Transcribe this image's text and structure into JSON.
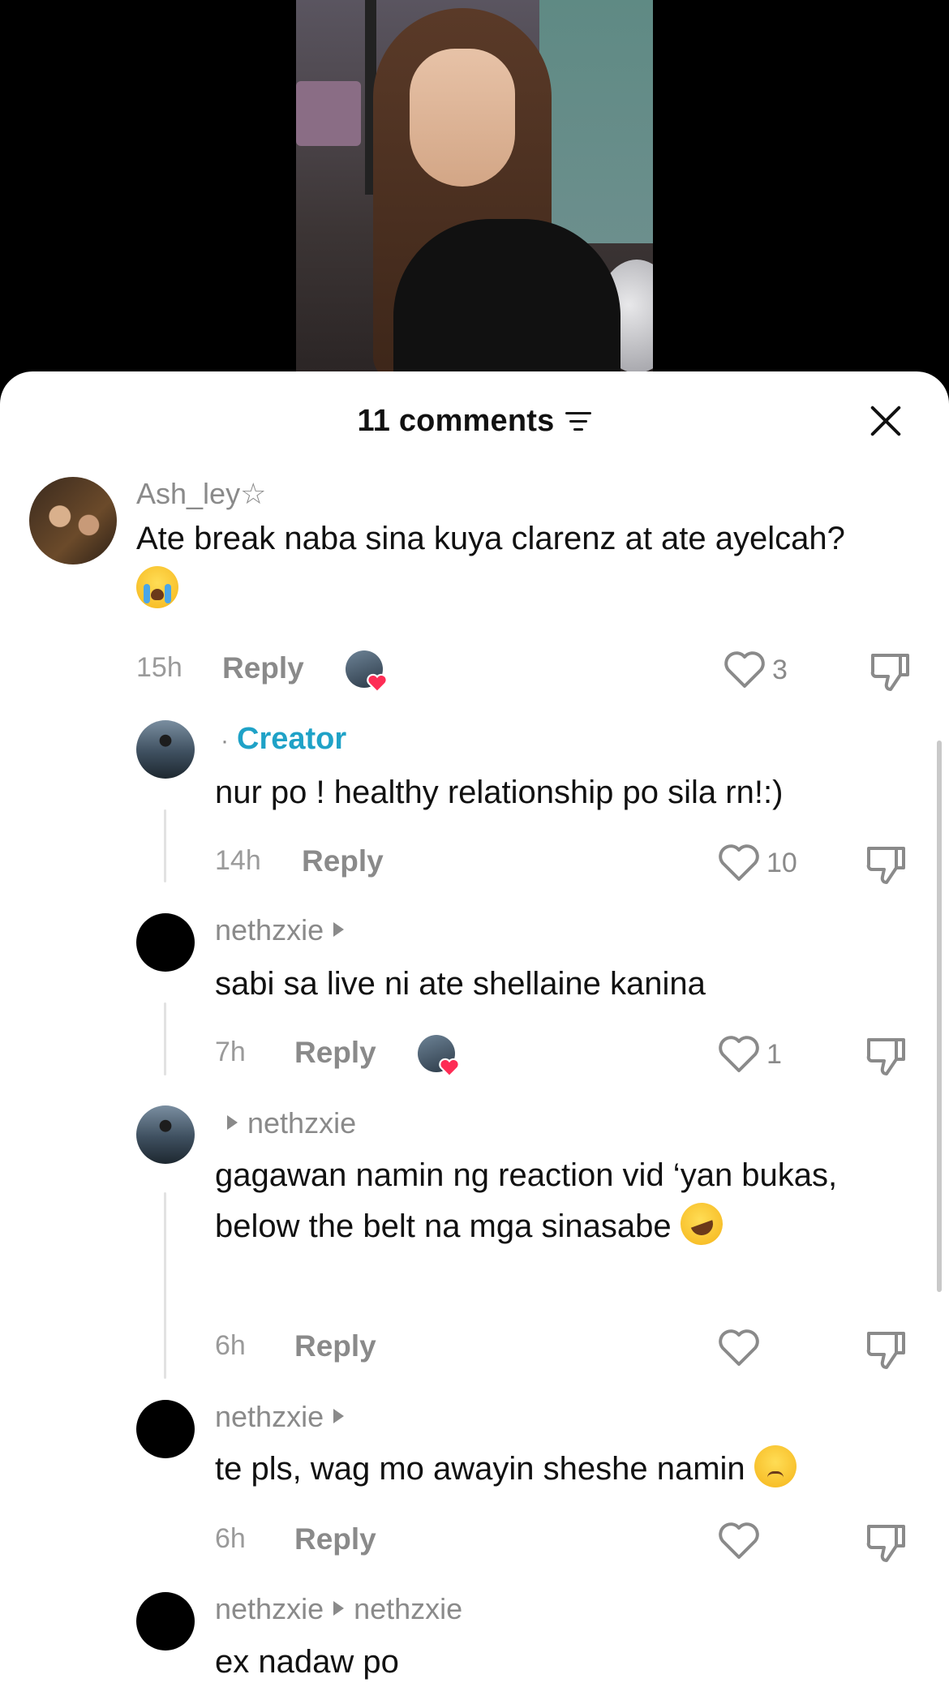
{
  "sheet": {
    "title": "11 comments"
  },
  "comments": [
    {
      "username": "Ash_ley☆",
      "text": "Ate break naba sina kuya clarenz at ate ayelcah?",
      "time": "15h",
      "reply_label": "Reply",
      "likes": "3"
    },
    {
      "creator_label": "Creator",
      "text": "nur po ! healthy relationship po sila rn!:)",
      "time": "14h",
      "reply_label": "Reply",
      "likes": "10"
    },
    {
      "username": "nethzxie",
      "text": "sabi sa live ni ate shellaine kanina",
      "time": "7h",
      "reply_label": "Reply",
      "likes": "1"
    },
    {
      "reply_to": "nethzxie",
      "text": "gagawan namin ng reaction vid ‘yan bukas, below the belt na mga sinasabe",
      "time": "6h",
      "reply_label": "Reply",
      "likes": ""
    },
    {
      "username": "nethzxie",
      "text": "te pls, wag mo awayin sheshe namin",
      "time": "6h",
      "reply_label": "Reply",
      "likes": ""
    },
    {
      "username": "nethzxie",
      "reply_to": "nethzxie",
      "text": "ex nadaw po"
    }
  ],
  "icons": {
    "sort": "sort-lines-icon",
    "close": "close-icon",
    "like": "heart-outline-icon",
    "dislike": "thumbs-down-icon",
    "creator_liked": "creator-liked-heart-icon"
  },
  "colors": {
    "creator_accent": "#1fa2c7",
    "like_heart": "#fe2c55"
  }
}
